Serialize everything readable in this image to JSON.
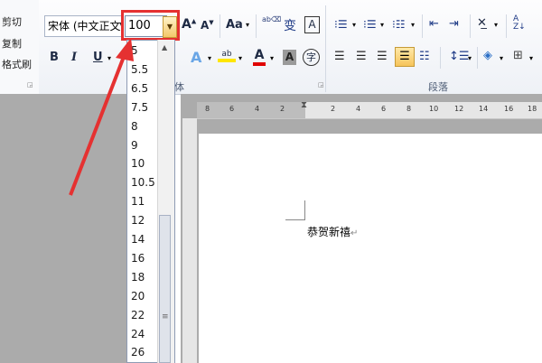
{
  "clipboard": {
    "cut": "剪切",
    "copy": "复制",
    "format_painter": "格式刷"
  },
  "font": {
    "name": "宋体 (中文正文)",
    "size_value": "100",
    "group_label": "体",
    "bold": "B",
    "italic": "I",
    "underline": "U",
    "change_case": "Aa",
    "phonetic": "变",
    "border_char": "A",
    "font_color_glyph": "A",
    "shade_glyph": "A",
    "enclose_glyph": "字"
  },
  "paragraph": {
    "group_label": "段落"
  },
  "size_options": [
    "5",
    "5.5",
    "6.5",
    "7.5",
    "8",
    "9",
    "10",
    "10.5",
    "11",
    "12",
    "14",
    "16",
    "18",
    "20",
    "22",
    "24",
    "26"
  ],
  "ruler": {
    "numbers": [
      "8",
      "6",
      "4",
      "2",
      "2",
      "4",
      "6",
      "8",
      "10",
      "12",
      "14",
      "16",
      "18"
    ]
  },
  "document": {
    "text": "恭贺新禧"
  },
  "colors": {
    "highlight": "#e53131"
  }
}
